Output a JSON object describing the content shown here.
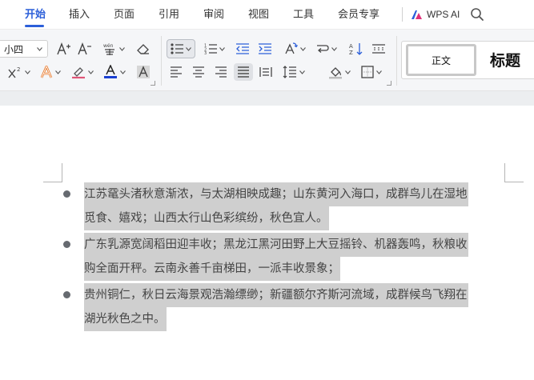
{
  "menu": {
    "tabs": [
      "开始",
      "插入",
      "页面",
      "引用",
      "审阅",
      "视图",
      "工具",
      "会员专享"
    ],
    "active_index": 0,
    "ai_label": "WPS AI"
  },
  "ribbon": {
    "font_size": "小四",
    "styles": {
      "normal": "正文",
      "heading": "标题"
    },
    "icons": {
      "font": [
        "grow-font-icon",
        "shrink-font-icon",
        "phonetic-guide-icon",
        "clear-format-icon",
        "superscript-icon",
        "text-effect-icon",
        "highlight-icon",
        "font-color-icon",
        "char-shading-icon"
      ],
      "paragraph": [
        "bullet-list-icon",
        "numbered-list-icon",
        "decrease-indent-icon",
        "increase-indent-icon",
        "text-direction-icon",
        "line-break-icon",
        "sort-icon",
        "show-marks-icon",
        "align-left-icon",
        "align-center-icon",
        "align-right-icon",
        "justify-icon",
        "distributed-icon",
        "line-spacing-icon",
        "shading-icon",
        "border-icon"
      ]
    },
    "colors": {
      "font_color": "#1a3fd1",
      "accent": "#2c5fd9"
    }
  },
  "document": {
    "bullets": [
      {
        "lines": [
          "江苏鼋头渚秋意渐浓，与太湖相映成趣；山东黄河入海口，成群鸟儿在湿地",
          "觅食、嬉戏；山西太行山色彩缤纷，秋色宜人。"
        ]
      },
      {
        "lines": [
          "广东乳源宽阔稻田迎丰收；黑龙江黑河田野上大豆摇铃、机器轰鸣，秋粮收",
          "购全面开秤。云南永善千亩梯田，一派丰收景象；"
        ]
      },
      {
        "lines": [
          "贵州铜仁，秋日云海景观浩瀚缥缈；新疆额尔齐斯河流域，成群候鸟飞翔在",
          "湖光秋色之中。"
        ]
      }
    ]
  }
}
